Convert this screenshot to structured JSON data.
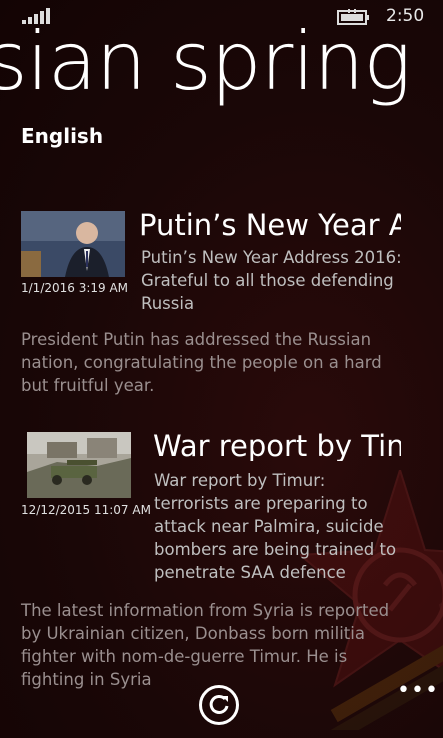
{
  "status_bar": {
    "time": "2:50",
    "signal_icon": "signal-strength-icon",
    "battery_icon": "battery-charging-icon"
  },
  "pivot": {
    "title": "sian spring",
    "header": "English"
  },
  "articles": [
    {
      "headline": "Putin’s New Year A",
      "subtitle": "Putin’s New Year Address 2016: Grateful to all those defending Russia",
      "date": "1/1/2016 3:19 AM",
      "summary": "President Putin has addressed the Russian nation, congratulating the people on a hard but fruitful year."
    },
    {
      "headline": "War report by Tin",
      "subtitle": "War report by Timur: terrorists are preparing to attack near Palmira, suicide bombers are being trained to penetrate SAA defence",
      "date": "12/12/2015 11:07 AM",
      "summary": "The latest information from Syria is reported by Ukrainian citizen, Donbass born militia fighter with nom-de-guerre Timur. He is fighting in Syria"
    }
  ],
  "app_bar": {
    "refresh_icon": "refresh-icon",
    "more_label": "•••"
  },
  "colors": {
    "background": "#1a0707",
    "text_primary": "#ffffff",
    "text_secondary": "#bfbfbf",
    "text_muted": "#9a8f8f"
  }
}
